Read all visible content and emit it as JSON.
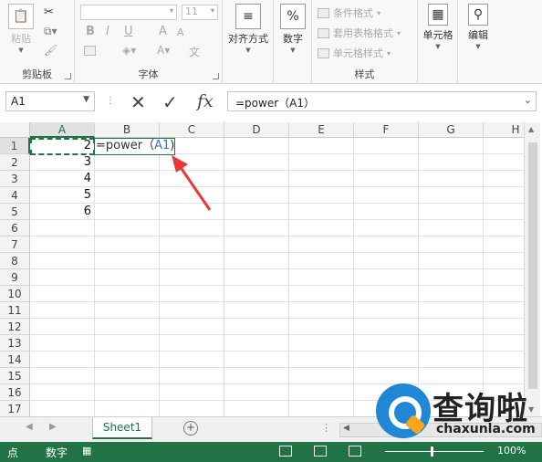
{
  "ribbon": {
    "clipboard": {
      "paste": "粘贴",
      "label": "剪贴板"
    },
    "font": {
      "label": "字体",
      "size": "11",
      "bold": "B",
      "italic": "I",
      "underline": "U",
      "grow": "A",
      "shrink": "A",
      "phonetic": "文"
    },
    "alignment": {
      "label": "对齐方式"
    },
    "number": {
      "label": "数字",
      "symbol": "%"
    },
    "styles": {
      "conditional": "条件格式",
      "table": "套用表格格式",
      "cell_styles": "单元格样式",
      "label": "样式"
    },
    "cells": {
      "label": "单元格"
    },
    "editing": {
      "label": "编辑"
    }
  },
  "formula_bar": {
    "name_box": "A1",
    "cancel": "✕",
    "enter": "✓",
    "fx": "fx",
    "content": "=power（A1）"
  },
  "columns": [
    "A",
    "B",
    "C",
    "D",
    "E",
    "F",
    "G",
    "H"
  ],
  "rows": [
    "1",
    "2",
    "3",
    "4",
    "5",
    "6",
    "7",
    "8",
    "9",
    "10",
    "11",
    "12",
    "13",
    "14",
    "15",
    "16",
    "17"
  ],
  "cells": {
    "A": [
      "2",
      "3",
      "4",
      "5",
      "6"
    ],
    "B1_prefix": "=power（",
    "B1_ref": "A1",
    "B1_suffix": ")"
  },
  "sheet_tabs": [
    "Sheet1"
  ],
  "status": {
    "mode": "点",
    "num": "数字",
    "zoom": "100%"
  },
  "watermark": {
    "brand_cn": "查询啦",
    "brand_en": "chaxunla.com"
  },
  "colors": {
    "excel_green": "#217346",
    "arrow_red": "#e8383a",
    "ref_blue": "#3c6ec5"
  }
}
